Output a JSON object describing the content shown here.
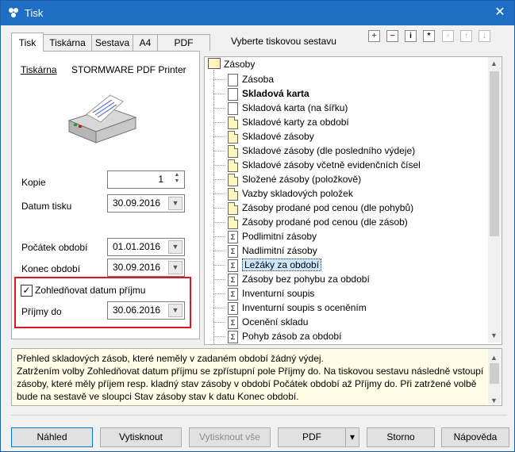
{
  "window": {
    "title": "Tisk",
    "close_glyph": "✕"
  },
  "tabs": [
    "Tisk",
    "Tiskárna",
    "Sestava",
    "A4",
    "PDF"
  ],
  "left": {
    "printer_label": "Tiskárna",
    "printer_name": "STORMWARE PDF Printer",
    "copies_label": "Kopie",
    "copies_value": "1",
    "print_date_label": "Datum tisku",
    "print_date_value": "30.09.2016",
    "period_start_label": "Počátek období",
    "period_start_value": "01.01.2016",
    "period_end_label": "Konec období",
    "period_end_value": "30.09.2016",
    "receipt_checkbox_label": "Zohledňovat datum příjmu",
    "receipt_checked": true,
    "receipts_to_label": "Příjmy do",
    "receipts_to_value": "30.06.2016"
  },
  "reports": {
    "title": "Vyberte tiskovou sestavu",
    "toolbar_icons": [
      "add-icon",
      "remove-icon",
      "info-icon",
      "star-icon",
      "copy-icon",
      "up-icon",
      "down-icon"
    ],
    "root": "Zásoby",
    "items": [
      {
        "label": "Zásoba",
        "icon": "doc",
        "bold": false
      },
      {
        "label": "Skladová karta",
        "icon": "doc",
        "bold": true
      },
      {
        "label": "Skladová karta (na šířku)",
        "icon": "doc",
        "bold": false
      },
      {
        "label": "Skladové karty za období",
        "icon": "doc-y",
        "bold": false
      },
      {
        "label": "Skladové zásoby",
        "icon": "doc-y",
        "bold": false
      },
      {
        "label": "Skladové zásoby (dle posledního výdeje)",
        "icon": "doc-y",
        "bold": false
      },
      {
        "label": "Skladové zásoby včetně evidenčních čísel",
        "icon": "doc-y",
        "bold": false
      },
      {
        "label": "Složené zásoby (položkově)",
        "icon": "doc-y",
        "bold": false
      },
      {
        "label": "Vazby skladových položek",
        "icon": "doc-y",
        "bold": false
      },
      {
        "label": "Zásoby prodané pod cenou (dle pohybů)",
        "icon": "doc-y",
        "bold": false
      },
      {
        "label": "Zásoby prodané pod cenou (dle zásob)",
        "icon": "doc-y",
        "bold": false
      },
      {
        "label": "Podlimitní zásoby",
        "icon": "sigma",
        "bold": false
      },
      {
        "label": "Nadlimitní zásoby",
        "icon": "sigma",
        "bold": false
      },
      {
        "label": "Ležáky za období",
        "icon": "sigma",
        "bold": false,
        "selected": true
      },
      {
        "label": "Zásoby bez pohybu za období",
        "icon": "sigma",
        "bold": false
      },
      {
        "label": "Inventurní soupis",
        "icon": "sigma",
        "bold": false
      },
      {
        "label": "Inventurní soupis s oceněním",
        "icon": "sigma",
        "bold": false
      },
      {
        "label": "Ocenění skladu",
        "icon": "sigma",
        "bold": false
      },
      {
        "label": "Pohyb zásob za období",
        "icon": "sigma",
        "bold": false
      }
    ]
  },
  "description": {
    "line1": "Přehled skladových zásob, které neměly v zadaném období žádný výdej.",
    "line2": "Zatržením volby Zohledňovat datum příjmu se zpřístupní pole Příjmy do. Na tiskovou sestavu následně vstoupí zásoby, které měly příjem resp. kladný stav zásoby v období Počátek období až Příjmy do. Při zatržené volbě bude na sestavě ve sloupci Stav zásoby stav k datu Konec období."
  },
  "buttons": {
    "preview": "Náhled",
    "print": "Vytisknout",
    "print_all": "Vytisknout vše",
    "pdf": "PDF",
    "cancel": "Storno",
    "help": "Nápověda"
  }
}
